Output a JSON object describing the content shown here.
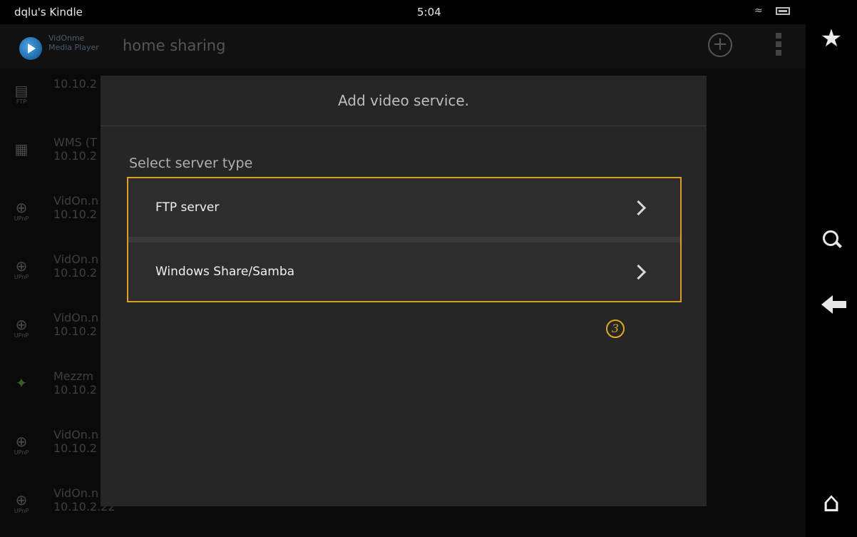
{
  "status_bar": {
    "device_name": "dqlu's Kindle",
    "time": "5:04",
    "wifi_icon": "wifi-icon",
    "battery_icon": "battery-icon"
  },
  "app_bar": {
    "app_name_line1": "VidOnme",
    "app_name_line2": "Media Player",
    "title": "home sharing",
    "add_icon": "plus-circle-icon",
    "overflow_icon": "overflow-menu-icon"
  },
  "servers": [
    {
      "icon": "ftp-icon",
      "icon_label": "FTP",
      "line1": "10.10.2",
      "line2": ""
    },
    {
      "icon": "wms-icon",
      "icon_label": "",
      "line1": "WMS (T",
      "line2": "10.10.2"
    },
    {
      "icon": "globe-icon",
      "icon_label": "UPnP",
      "line1": "VidOn.n",
      "line2": "10.10.2"
    },
    {
      "icon": "globe-icon",
      "icon_label": "UPnP",
      "line1": "VidOn.n",
      "line2": "10.10.2"
    },
    {
      "icon": "globe-icon",
      "icon_label": "UPnP",
      "line1": "VidOn.n",
      "line2": "10.10.2"
    },
    {
      "icon": "mezzmo-icon",
      "icon_label": "",
      "line1": "Mezzm",
      "line2": "10.10.2"
    },
    {
      "icon": "globe-icon",
      "icon_label": "UPnP",
      "line1": "VidOn.n",
      "line2": "10.10.2"
    },
    {
      "icon": "globe-icon",
      "icon_label": "UPnP",
      "line1": "VidOn.n",
      "line2": "10.10.2.22"
    }
  ],
  "sidebar": {
    "favorite_icon": "star-icon",
    "search_icon": "search-icon",
    "back_icon": "back-arrow-icon",
    "home_icon": "home-icon"
  },
  "dialog": {
    "title": "Add video service.",
    "section_label": "Select server type",
    "options": [
      {
        "label": "FTP server"
      },
      {
        "label": "Windows Share/Samba"
      }
    ],
    "step_marker": "3"
  },
  "colors": {
    "highlight": "#d9a023",
    "dialog_bg": "#262626",
    "background": "#0c0c0c"
  }
}
